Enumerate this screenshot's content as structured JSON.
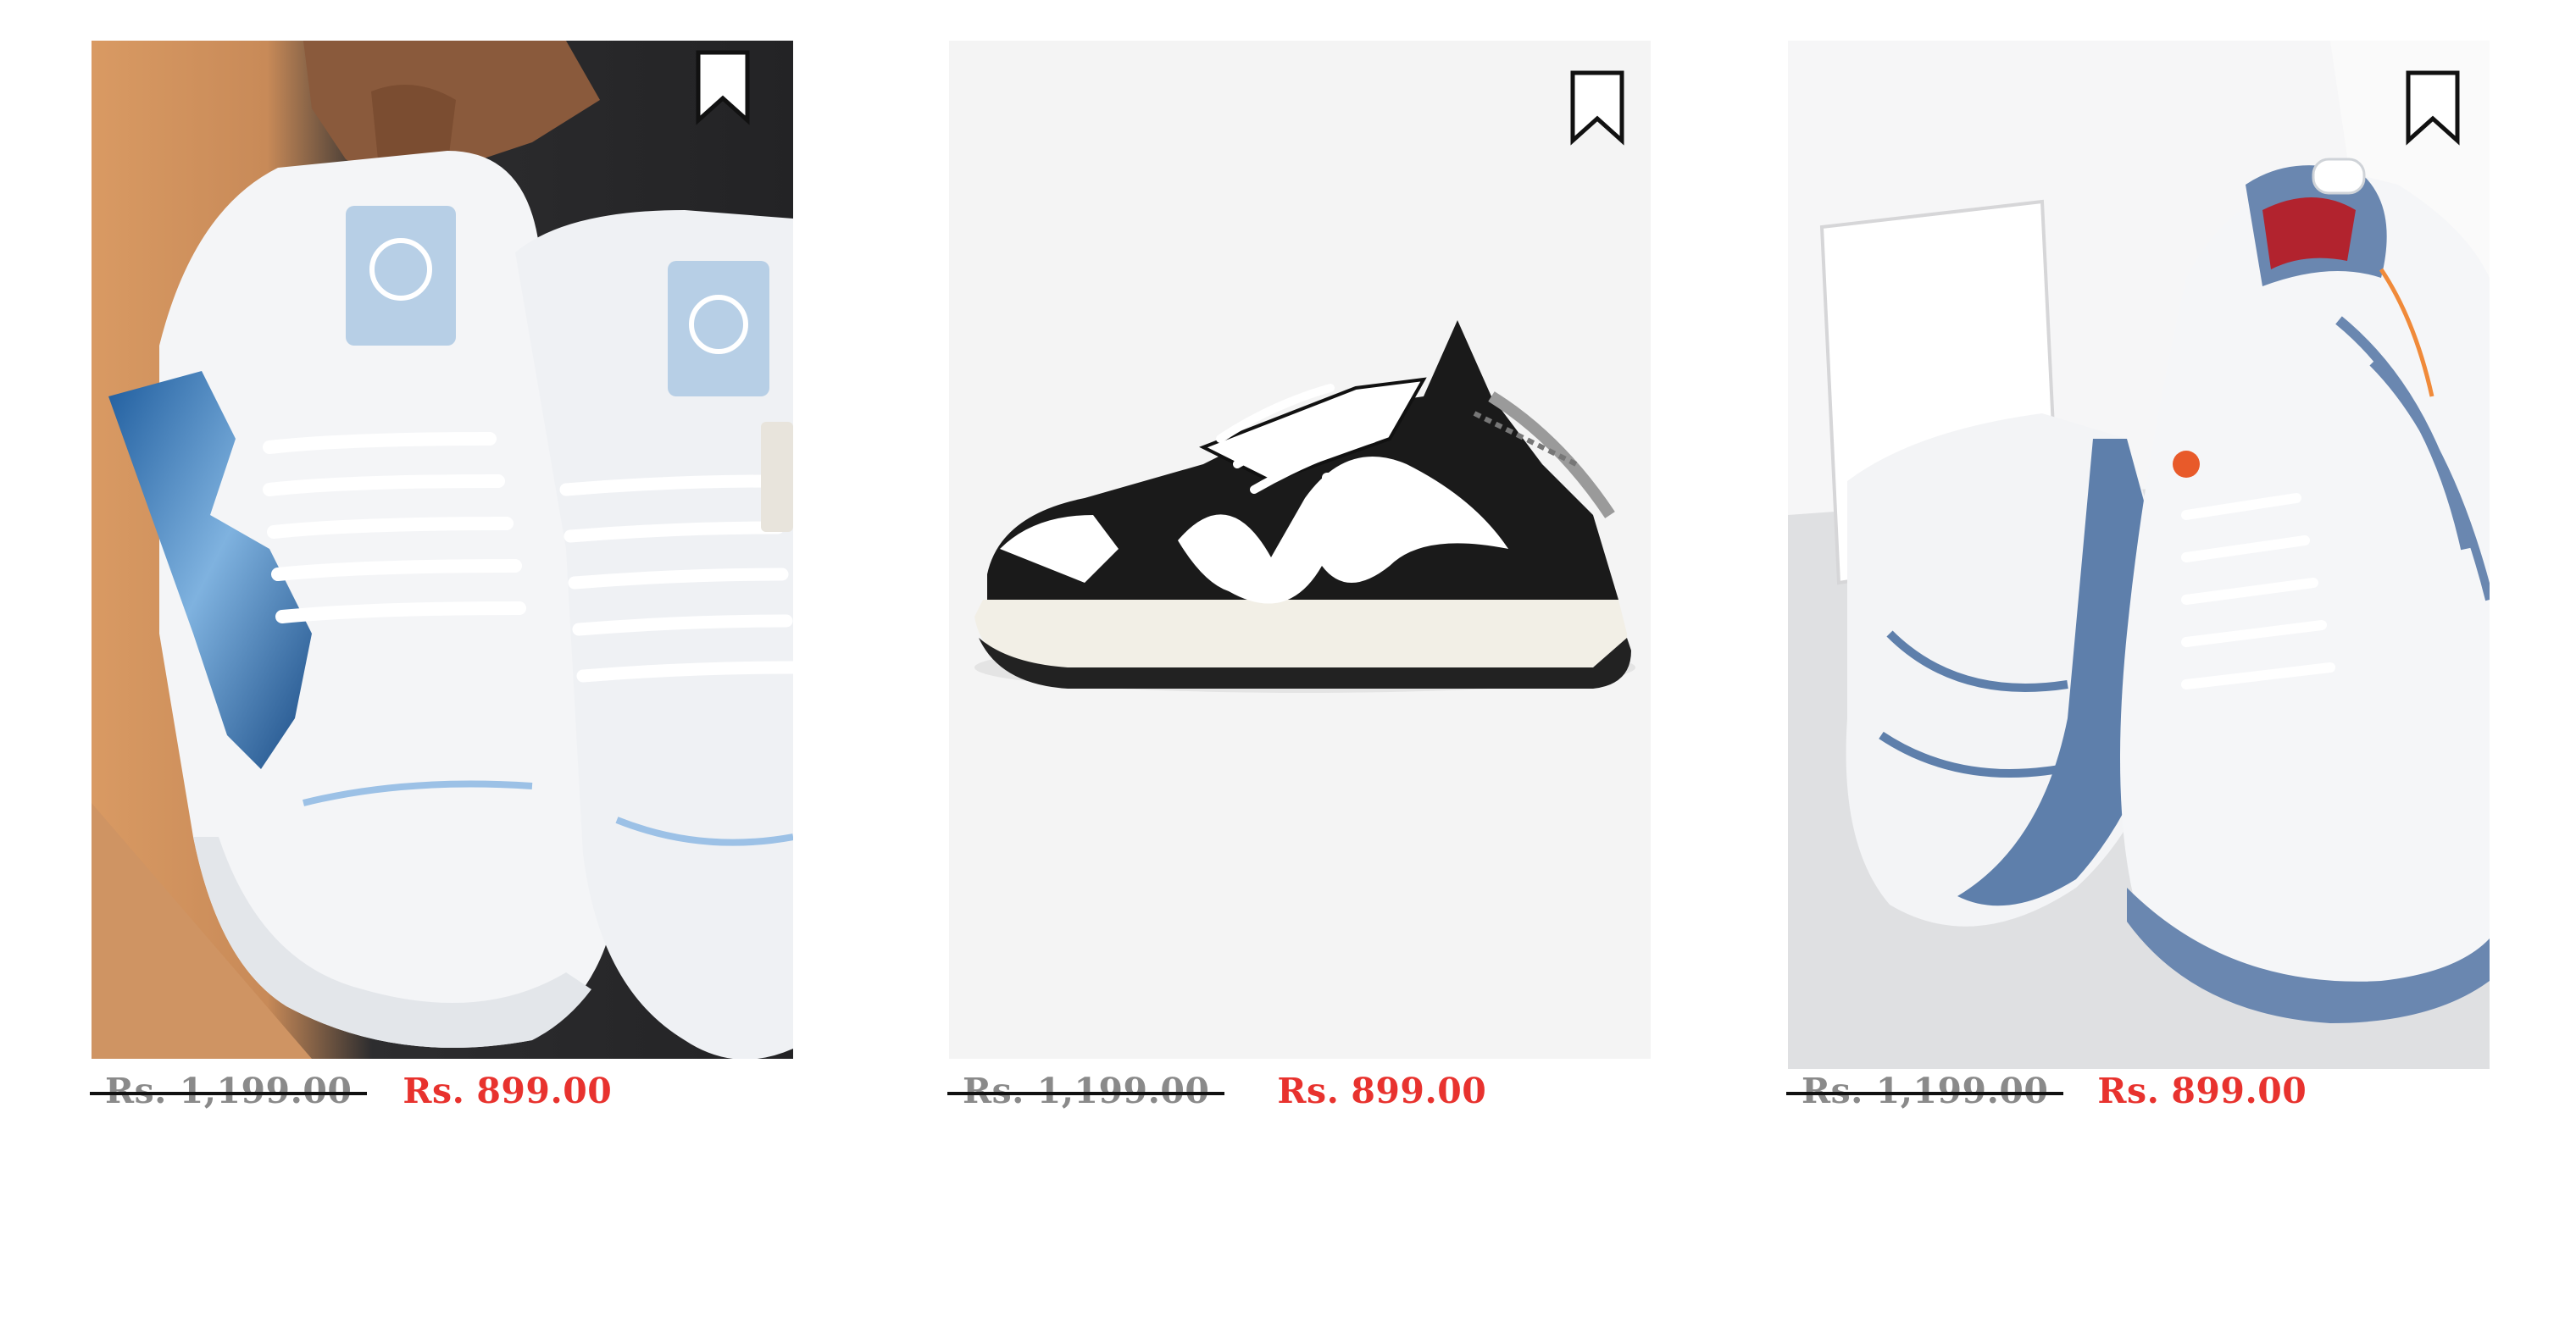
{
  "products": [
    {
      "image_alt": "White high-top sneakers with blue wave panel",
      "old_price": "Rs. 1,199.00",
      "currency": "Rs.",
      "new_price": "899.00"
    },
    {
      "image_alt": "Black and white low-top sneaker",
      "old_price": "Rs. 1,199.00",
      "currency": "Rs.",
      "new_price": "899.00"
    },
    {
      "image_alt": "White and blue running shoes",
      "old_price": "Rs. 1,199.00",
      "currency": "Rs.",
      "new_price": "899.00"
    }
  ],
  "icons": {
    "bookmark": "bookmark-icon"
  },
  "colors": {
    "sale_price": "#e8322e",
    "old_price": "#8a8a8a",
    "strike": "#111111"
  }
}
